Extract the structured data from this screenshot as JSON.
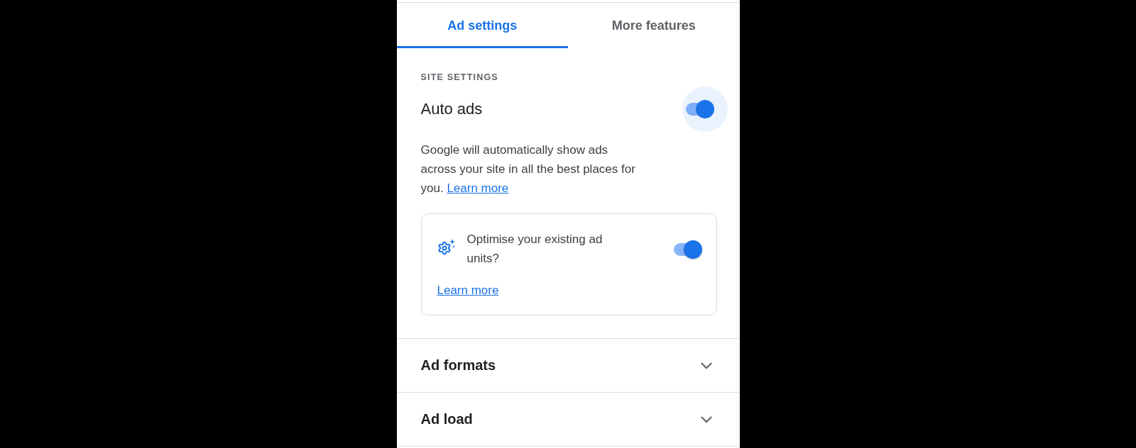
{
  "tabs": [
    {
      "label": "Ad settings",
      "selected": true
    },
    {
      "label": "More features",
      "selected": false
    }
  ],
  "section_label": "SITE SETTINGS",
  "auto_ads": {
    "title": "Auto ads",
    "on": true,
    "focused": true,
    "description": "Google will automatically show ads across your site in all the best places for you.",
    "link": "Learn more"
  },
  "optimise_card": {
    "text": "Optimise your existing ad units?",
    "on": true,
    "link": "Learn more"
  },
  "sections": [
    {
      "title": "Ad formats",
      "expanded": false
    },
    {
      "title": "Ad load",
      "expanded": false
    }
  ]
}
